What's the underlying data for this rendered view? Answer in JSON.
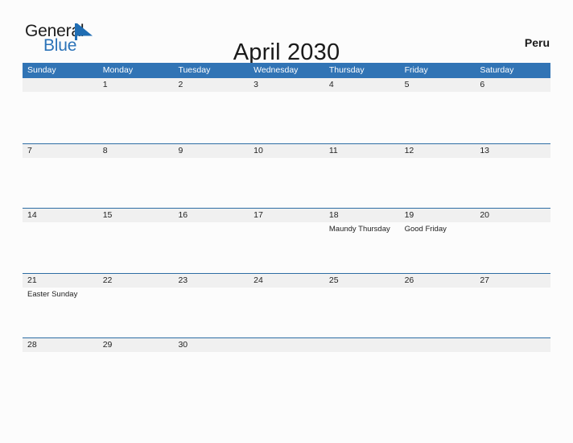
{
  "brand": {
    "word_one": "General",
    "word_two": "Blue",
    "flag_icon": "blue-triangle-flag-icon",
    "color_primary": "#2b73b8",
    "color_text": "#1d1d1d"
  },
  "header": {
    "title": "April 2030",
    "country": "Peru"
  },
  "theme": {
    "header_blue": "#3174b5",
    "row_divider_blue": "#2e6da4",
    "daynum_band_gray": "#f0f0f0",
    "page_background": "#fcfcfc",
    "text_color": "#222222"
  },
  "calendar": {
    "weekdays": [
      "Sunday",
      "Monday",
      "Tuesday",
      "Wednesday",
      "Thursday",
      "Friday",
      "Saturday"
    ],
    "weeks": [
      {
        "days": [
          {
            "num": "",
            "event": ""
          },
          {
            "num": "1",
            "event": ""
          },
          {
            "num": "2",
            "event": ""
          },
          {
            "num": "3",
            "event": ""
          },
          {
            "num": "4",
            "event": ""
          },
          {
            "num": "5",
            "event": ""
          },
          {
            "num": "6",
            "event": ""
          }
        ]
      },
      {
        "days": [
          {
            "num": "7",
            "event": ""
          },
          {
            "num": "8",
            "event": ""
          },
          {
            "num": "9",
            "event": ""
          },
          {
            "num": "10",
            "event": ""
          },
          {
            "num": "11",
            "event": ""
          },
          {
            "num": "12",
            "event": ""
          },
          {
            "num": "13",
            "event": ""
          }
        ]
      },
      {
        "days": [
          {
            "num": "14",
            "event": ""
          },
          {
            "num": "15",
            "event": ""
          },
          {
            "num": "16",
            "event": ""
          },
          {
            "num": "17",
            "event": ""
          },
          {
            "num": "18",
            "event": "Maundy Thursday"
          },
          {
            "num": "19",
            "event": "Good Friday"
          },
          {
            "num": "20",
            "event": ""
          }
        ]
      },
      {
        "days": [
          {
            "num": "21",
            "event": "Easter Sunday"
          },
          {
            "num": "22",
            "event": ""
          },
          {
            "num": "23",
            "event": ""
          },
          {
            "num": "24",
            "event": ""
          },
          {
            "num": "25",
            "event": ""
          },
          {
            "num": "26",
            "event": ""
          },
          {
            "num": "27",
            "event": ""
          }
        ]
      },
      {
        "days": [
          {
            "num": "28",
            "event": ""
          },
          {
            "num": "29",
            "event": ""
          },
          {
            "num": "30",
            "event": ""
          },
          {
            "num": "",
            "event": ""
          },
          {
            "num": "",
            "event": ""
          },
          {
            "num": "",
            "event": ""
          },
          {
            "num": "",
            "event": ""
          }
        ]
      }
    ]
  }
}
